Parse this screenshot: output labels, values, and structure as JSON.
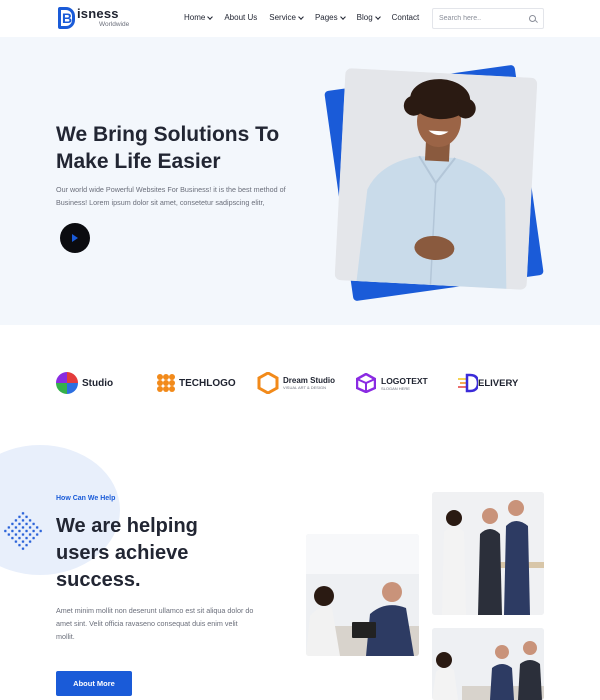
{
  "header": {
    "logo_letter": "B",
    "logo_name": "isness",
    "logo_sub": "Worldwide",
    "nav": [
      {
        "label": "Home",
        "dropdown": true
      },
      {
        "label": "About Us",
        "dropdown": false
      },
      {
        "label": "Service",
        "dropdown": true
      },
      {
        "label": "Pages",
        "dropdown": true
      },
      {
        "label": "Blog",
        "dropdown": true
      },
      {
        "label": "Contact",
        "dropdown": false
      }
    ],
    "search_placeholder": "Search here.."
  },
  "hero": {
    "title_line1": "We Bring Solutions To",
    "title_line2": "Make Life Easier",
    "text": "Our world wide Powerful Websites For Business! it is the best method of Business! Lorem ipsum dolor sit amet, consetetur sadipscing elitr,"
  },
  "brands": [
    {
      "name": "Studio",
      "icon": "pinwheel-icon",
      "color": "#e43c3c"
    },
    {
      "name": "TECHLOGO",
      "icon": "dots-grid-icon",
      "color": "#f28a1a"
    },
    {
      "name": "Dream Studio",
      "sub": "VISUAL ART & DESIGN",
      "icon": "hexagon-icon",
      "color": "#f28a1a"
    },
    {
      "name": "LOGOTEXT",
      "sub": "SLOGAN HERE",
      "icon": "cube-icon",
      "color": "#8a2be2"
    },
    {
      "name": "ELIVERY",
      "icon": "d-letter-icon",
      "color": "#3b2bd9"
    }
  ],
  "about": {
    "tag": "How Can We Help",
    "title_line1": "We are helping",
    "title_line2": "users achieve",
    "title_line3": "success.",
    "text": "Amet minim mollit non deserunt ullamco est sit aliqua dolor do amet sint. Velit officia ravaseno consequat duis enim velit mollit.",
    "button": "About More"
  },
  "colors": {
    "accent": "#1a5bd8",
    "hero_bg": "#f3f7fc",
    "dark": "#222633"
  }
}
